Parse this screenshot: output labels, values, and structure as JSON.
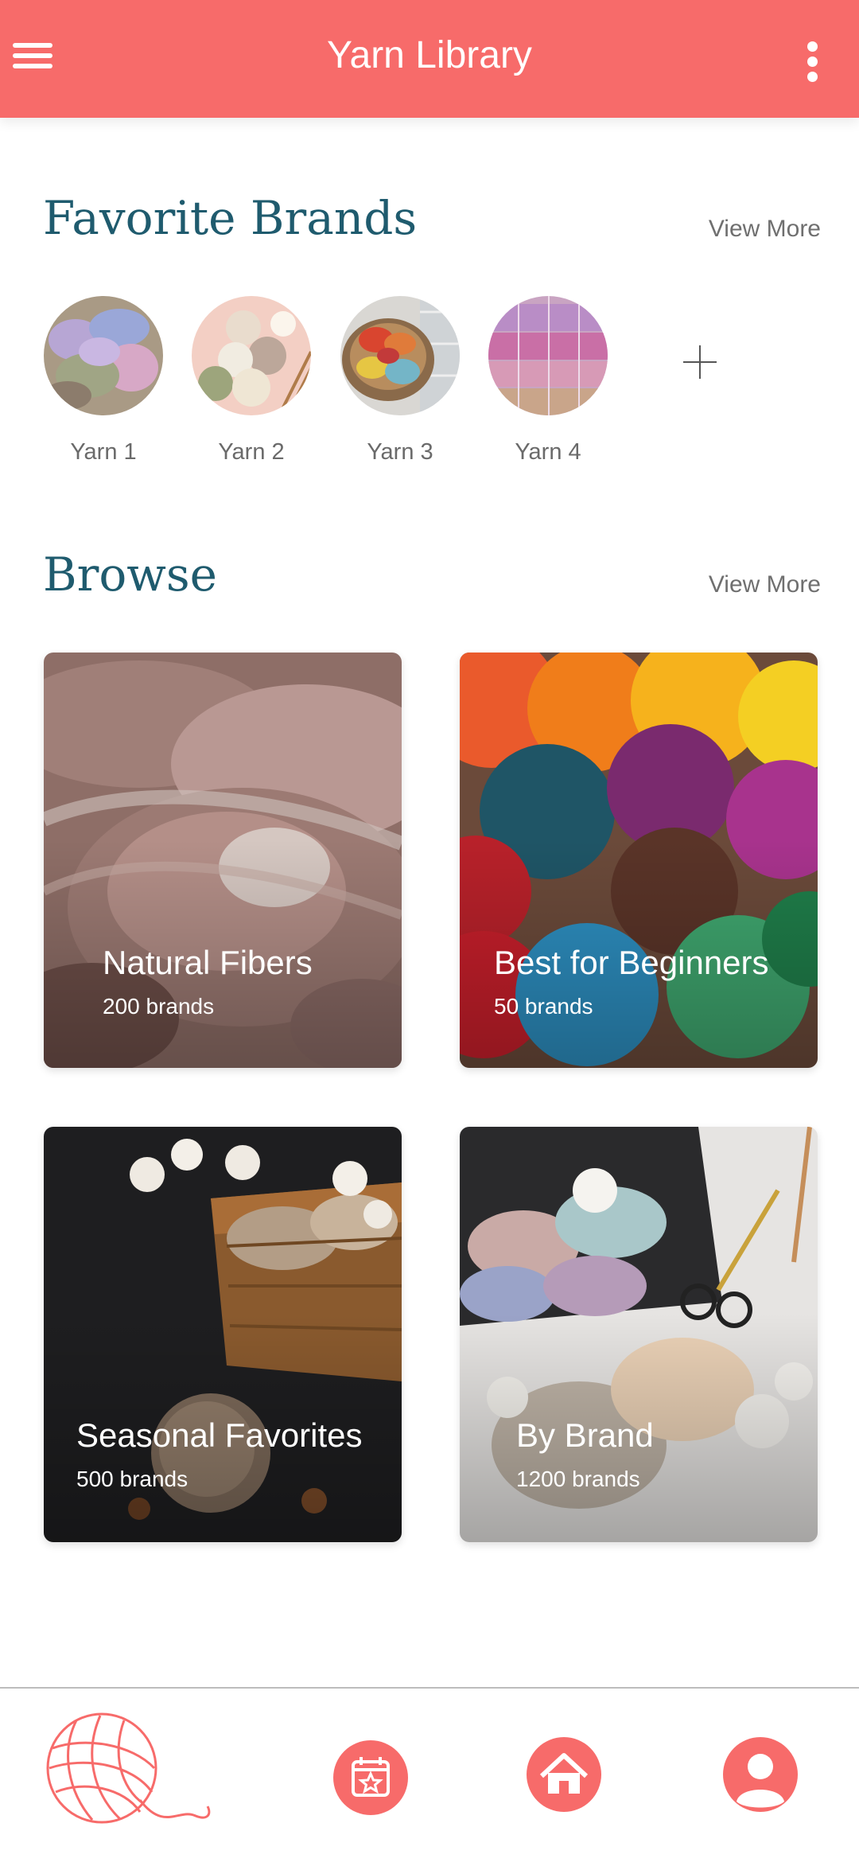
{
  "header": {
    "title": "Yarn Library",
    "menu_icon": "hamburger-menu-icon",
    "more_icon": "vertical-dots-icon",
    "color": "#f76b6a"
  },
  "favorites": {
    "title": "Favorite Brands",
    "view_more": "View More",
    "brands": [
      {
        "label": "Yarn 1"
      },
      {
        "label": "Yarn 2"
      },
      {
        "label": "Yarn 3"
      },
      {
        "label": "Yarn 4"
      }
    ],
    "add_icon": "plus-icon"
  },
  "browse": {
    "title": "Browse",
    "view_more": "View More",
    "cards": [
      {
        "title": "Natural Fibers",
        "subtitle": "200 brands"
      },
      {
        "title": "Best for Beginners",
        "subtitle": "50 brands"
      },
      {
        "title": "Seasonal Favorites",
        "subtitle": "500 brands"
      },
      {
        "title": "By Brand",
        "subtitle": "1200 brands"
      }
    ]
  },
  "bottom_nav": {
    "items": [
      {
        "icon": "yarn-ball-icon"
      },
      {
        "icon": "calendar-star-icon"
      },
      {
        "icon": "home-icon"
      },
      {
        "icon": "profile-icon"
      }
    ],
    "accent": "#f76b6a"
  },
  "colors": {
    "accent": "#f76b6a",
    "section_title": "#1f5b6e"
  }
}
